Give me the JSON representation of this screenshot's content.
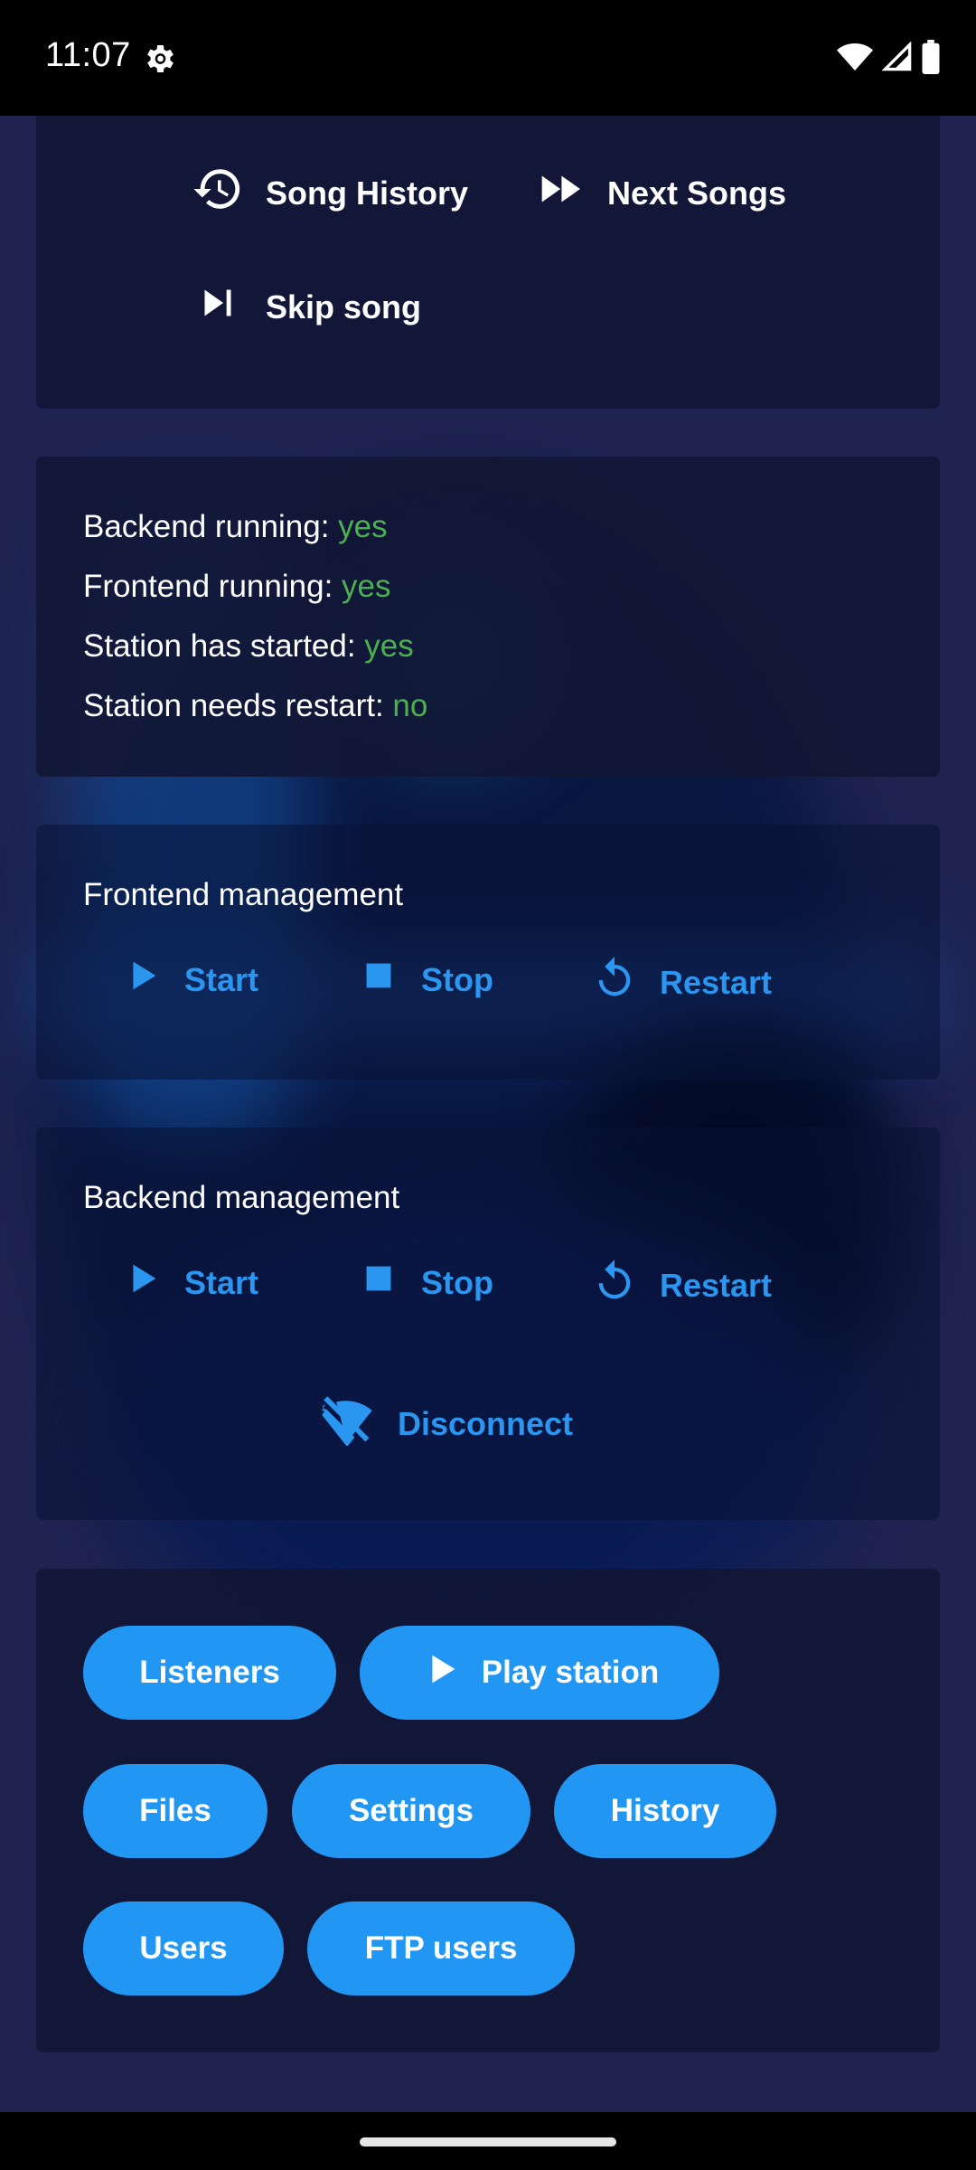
{
  "status_bar": {
    "time": "11:07"
  },
  "song_actions": {
    "history_label": "Song History",
    "next_label": "Next Songs",
    "skip_label": "Skip song"
  },
  "status": {
    "backend_label": "Backend running: ",
    "backend_value": "yes",
    "frontend_label": "Frontend running: ",
    "frontend_value": "yes",
    "started_label": "Station has started: ",
    "started_value": "yes",
    "restart_label": "Station needs restart: ",
    "restart_value": "no",
    "value_color": "#4caf50"
  },
  "frontend": {
    "title": "Frontend management",
    "start_label": "Start",
    "stop_label": "Stop",
    "restart_label": "Restart"
  },
  "backend": {
    "title": "Backend management",
    "start_label": "Start",
    "stop_label": "Stop",
    "restart_label": "Restart",
    "disconnect_label": "Disconnect"
  },
  "nav_buttons": {
    "listeners": "Listeners",
    "play_station": "Play station",
    "files": "Files",
    "settings": "Settings",
    "history": "History",
    "users": "Users",
    "ftp_users": "FTP users"
  },
  "colors": {
    "accent": "#2196f3",
    "accent_text": "#2a96f0",
    "card": "#121634",
    "background": "#1f2452"
  }
}
